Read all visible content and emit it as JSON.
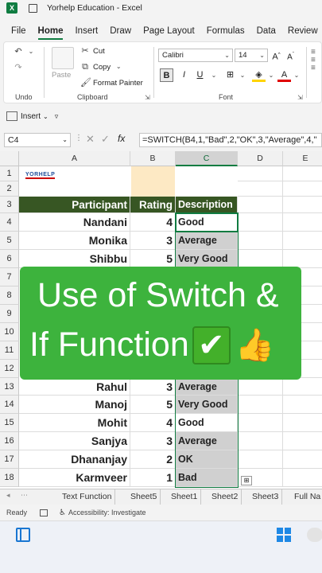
{
  "window": {
    "title": "Yorhelp Education  -  Excel",
    "app_icon": "X"
  },
  "menu": {
    "tabs": [
      "File",
      "Home",
      "Insert",
      "Draw",
      "Page Layout",
      "Formulas",
      "Data",
      "Review"
    ],
    "active": "Home"
  },
  "ribbon": {
    "undo_label": "Undo",
    "clipboard": {
      "label": "Clipboard",
      "paste": "Paste",
      "cut": "Cut",
      "copy": "Copy",
      "format_painter": "Format Painter"
    },
    "font": {
      "label": "Font",
      "family": "Calibri",
      "size": "14",
      "bold": "B",
      "italic": "I",
      "underline": "U",
      "grow": "A",
      "shrink": "A"
    }
  },
  "quickbar": {
    "insert_label": "Insert"
  },
  "formula_bar": {
    "name_box": "C4",
    "fx": "fx",
    "formula": "=SWITCH(B4,1,\"Bad\",2,\"OK\",3,\"Average\",4,\""
  },
  "grid": {
    "columns": [
      "A",
      "B",
      "C",
      "D",
      "E"
    ],
    "rows": [
      "1",
      "2",
      "3",
      "4",
      "5",
      "6",
      "7",
      "8",
      "9",
      "10",
      "11",
      "12",
      "13",
      "14",
      "15",
      "16",
      "17",
      "18"
    ],
    "logo_text": "YORHELP",
    "headers": {
      "participant": "Participant",
      "rating": "Rating",
      "description": "Description"
    },
    "data_rows": [
      {
        "row": "4",
        "name": "Nandani",
        "rating": "4",
        "desc": "Good"
      },
      {
        "row": "5",
        "name": "Monika",
        "rating": "3",
        "desc": "Average"
      },
      {
        "row": "6",
        "name": "Shibbu",
        "rating": "5",
        "desc": "Very Good"
      },
      {
        "row": "13",
        "name": "Rahul",
        "rating": "3",
        "desc": "Average"
      },
      {
        "row": "14",
        "name": "Manoj",
        "rating": "5",
        "desc": "Very Good"
      },
      {
        "row": "15",
        "name": "Mohit",
        "rating": "4",
        "desc": "Good"
      },
      {
        "row": "16",
        "name": "Sanjya",
        "rating": "3",
        "desc": "Average"
      },
      {
        "row": "17",
        "name": "Dhananjay",
        "rating": "2",
        "desc": "OK"
      },
      {
        "row": "18",
        "name": "Karmveer",
        "rating": "1",
        "desc": "Bad"
      }
    ]
  },
  "banner": {
    "line1": "Use of Switch &",
    "line2": "If Function",
    "check": "✔",
    "thumb": "👍"
  },
  "sheet_tabs": [
    "Text Function",
    "Sheet5",
    "Sheet1",
    "Sheet2",
    "Sheet3",
    "Full Na"
  ],
  "status": {
    "ready": "Ready",
    "accessibility": "Accessibility: Investigate"
  },
  "colors": {
    "excel_green": "#107c41",
    "header_fill": "#375623",
    "banner_green": "#3db33d"
  }
}
